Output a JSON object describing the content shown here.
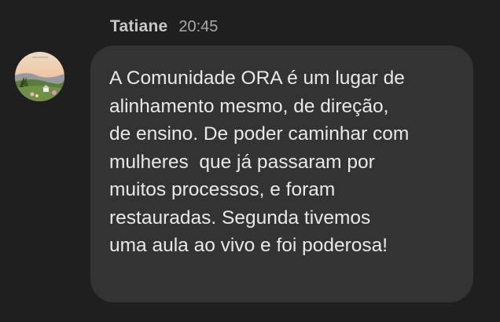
{
  "message": {
    "sender": "Tatiane",
    "time": "20:45",
    "lines": [
      "A Comunidade ORA é um lugar de",
      "alinhamento mesmo, de direção,",
      "de ensino. De poder caminhar com",
      "mulheres  que já passaram por",
      "muitos processos, e foram",
      "restauradas. Segunda tivemos",
      "uma aula ao vivo e foi poderosa!"
    ]
  },
  "avatar": {
    "icon": "landscape-painting-avatar"
  },
  "colors": {
    "background": "#1f1f1f",
    "bubble": "#333333",
    "sender_text": "#c7c7c7",
    "time_text": "#a8a8a8",
    "message_text": "#e8e8e8"
  }
}
